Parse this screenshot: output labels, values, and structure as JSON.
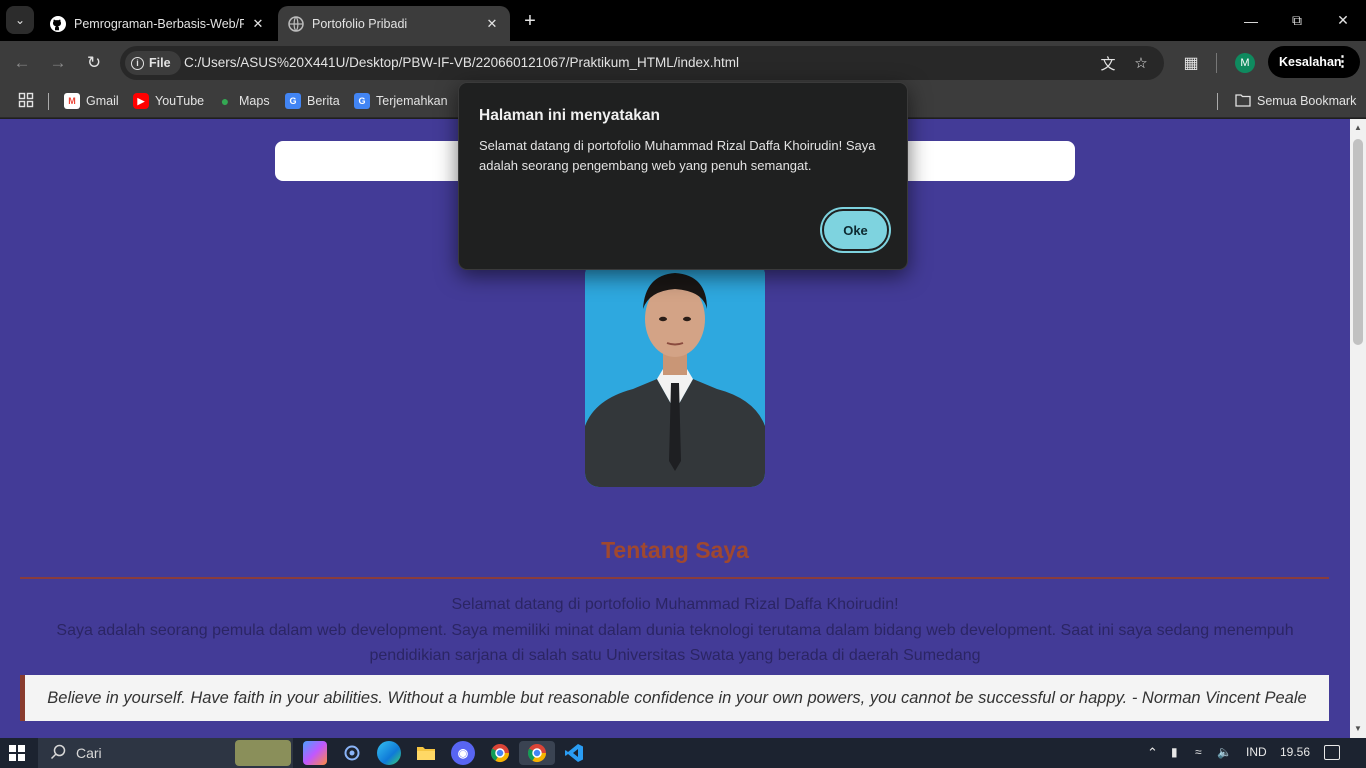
{
  "browser": {
    "tabs": [
      {
        "title": "Pemrograman-Berbasis-Web/PBW-IF-VB",
        "favicon": "github-icon",
        "active": false
      },
      {
        "title": "Portofolio Pribadi",
        "favicon": "globe-icon",
        "active": true
      }
    ],
    "address": {
      "scheme_chip": "File",
      "url": "C:/Users/ASUS%20X441U/Desktop/PBW-IF-VB/220660121067/Praktikum_HTML/index.html"
    },
    "profile_initial": "M",
    "error_button": "Kesalahan",
    "bookmarks": [
      {
        "label": "Gmail",
        "icon": "gmail-icon",
        "color": "#ea4335"
      },
      {
        "label": "YouTube",
        "icon": "youtube-icon",
        "color": "#ff0000"
      },
      {
        "label": "Maps",
        "icon": "maps-icon",
        "color": "#34a853"
      },
      {
        "label": "Berita",
        "icon": "news-icon",
        "color": "#4285f4"
      },
      {
        "label": "Terjemahkan",
        "icon": "translate-icon",
        "color": "#4285f4"
      }
    ],
    "all_bookmarks": "Semua Bookmark"
  },
  "page": {
    "background": "#433b97",
    "section_title": "Tentang Saya",
    "intro_line1": "Selamat datang di portofolio Muhammad Rizal Daffa Khoirudin!",
    "intro_line2": "Saya adalah seorang pemula dalam web development. Saya memiliki minat dalam dunia teknologi terutama dalam bidang web development. Saat ini saya sedang menempuh pendidikian sarjana di salah satu Universitas Swata yang berada di daerah Sumedang",
    "quote": "Believe in yourself. Have faith in your abilities. Without a humble but reasonable confidence in your own powers, you cannot be successful or happy. - Norman Vincent Peale"
  },
  "dialog": {
    "title": "Halaman ini menyatakan",
    "message": "Selamat datang di portofolio Muhammad Rizal Daffa Khoirudin! Saya adalah seorang pengembang web yang penuh semangat.",
    "ok_label": "Oke",
    "accent": "#7ed3df"
  },
  "taskbar": {
    "search_label": "Cari",
    "language": "IND",
    "time": "19.56"
  }
}
